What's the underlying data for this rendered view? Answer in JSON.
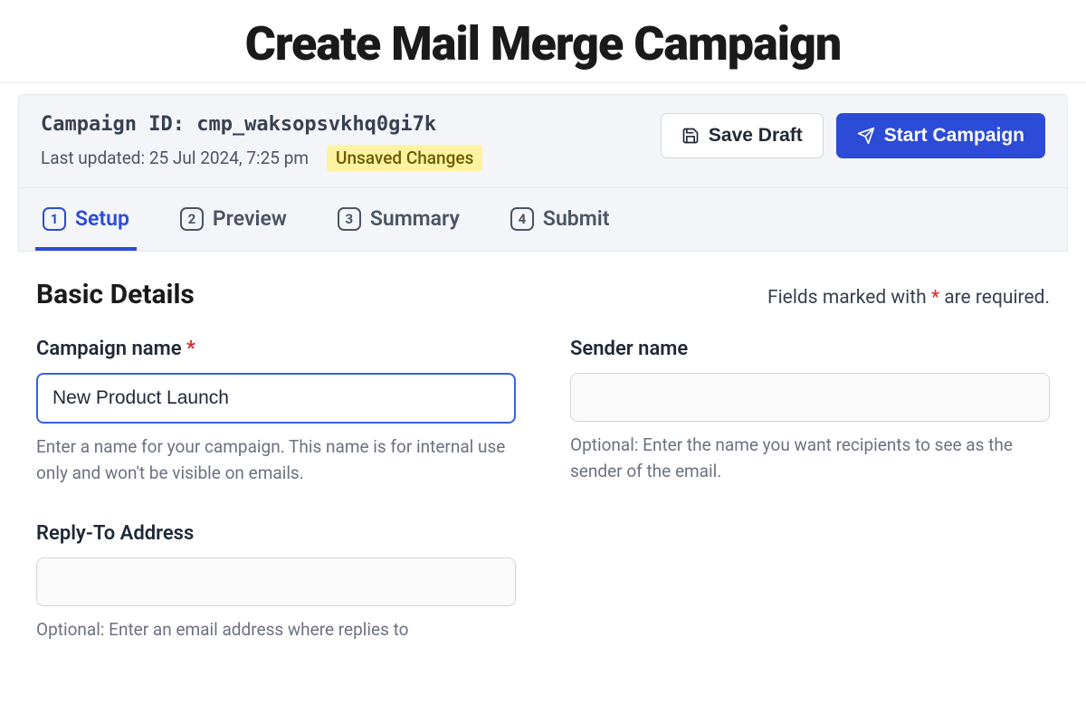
{
  "page_title": "Create Mail Merge Campaign",
  "header": {
    "campaign_id_label": "Campaign ID:",
    "campaign_id_value": "cmp_waksopsvkhq0gi7k",
    "last_updated_label": "Last updated:",
    "last_updated_value": "25 Jul 2024, 7:25 pm",
    "unsaved_badge": "Unsaved Changes",
    "save_draft_label": "Save Draft",
    "start_campaign_label": "Start Campaign"
  },
  "tabs": [
    {
      "num": "1",
      "label": "Setup"
    },
    {
      "num": "2",
      "label": "Preview"
    },
    {
      "num": "3",
      "label": "Summary"
    },
    {
      "num": "4",
      "label": "Submit"
    }
  ],
  "section": {
    "title": "Basic Details",
    "required_note_pre": "Fields marked with ",
    "required_note_post": " are required."
  },
  "fields": {
    "campaign_name": {
      "label": "Campaign name",
      "required": true,
      "value": "New Product Launch",
      "hint": "Enter a name for your campaign. This name is for internal use only and won't be visible on emails."
    },
    "sender_name": {
      "label": "Sender name",
      "value": "",
      "hint": "Optional: Enter the name you want recipients to see as the sender of the email."
    },
    "reply_to": {
      "label": "Reply-To Address",
      "value": "",
      "hint": "Optional: Enter an email address where replies to"
    }
  }
}
